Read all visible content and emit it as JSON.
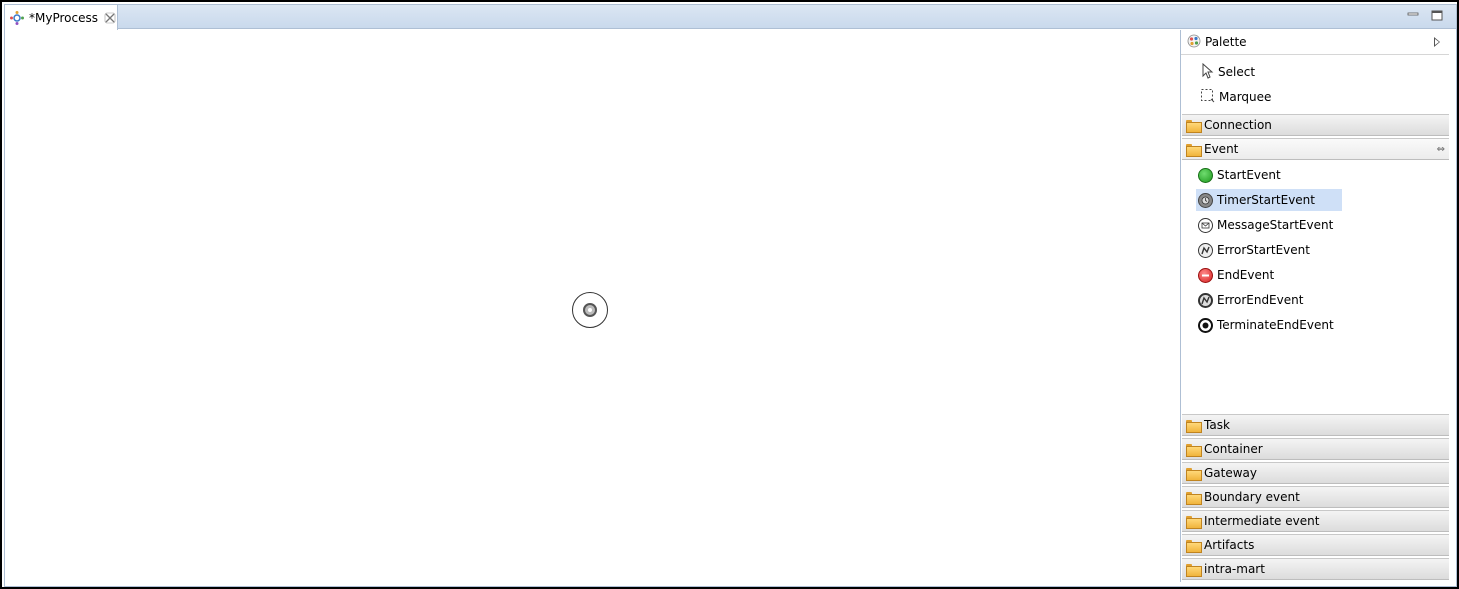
{
  "editor": {
    "tab_label": "*MyProcess"
  },
  "palette": {
    "title": "Palette",
    "tools": [
      {
        "label": "Select",
        "icon": "arrow-pointer-icon"
      },
      {
        "label": "Marquee",
        "icon": "marquee-icon"
      }
    ],
    "drawers_top": [
      {
        "label": "Connection"
      }
    ],
    "event_drawer": {
      "label": "Event",
      "items": [
        {
          "label": "StartEvent",
          "icon": "start-event-icon"
        },
        {
          "label": "TimerStartEvent",
          "icon": "timer-start-event-icon",
          "selected": true
        },
        {
          "label": "MessageStartEvent",
          "icon": "message-start-event-icon"
        },
        {
          "label": "ErrorStartEvent",
          "icon": "error-start-event-icon"
        },
        {
          "label": "EndEvent",
          "icon": "end-event-icon"
        },
        {
          "label": "ErrorEndEvent",
          "icon": "error-end-event-icon"
        },
        {
          "label": "TerminateEndEvent",
          "icon": "terminate-end-event-icon"
        }
      ]
    },
    "drawers_bottom": [
      {
        "label": "Task"
      },
      {
        "label": "Container"
      },
      {
        "label": "Gateway"
      },
      {
        "label": "Boundary event"
      },
      {
        "label": "Intermediate event"
      },
      {
        "label": "Artifacts"
      },
      {
        "label": "intra-mart"
      }
    ]
  },
  "colors": {
    "selection": "#cfe0f7",
    "start_event": "#22a022",
    "end_event": "#e03030"
  }
}
